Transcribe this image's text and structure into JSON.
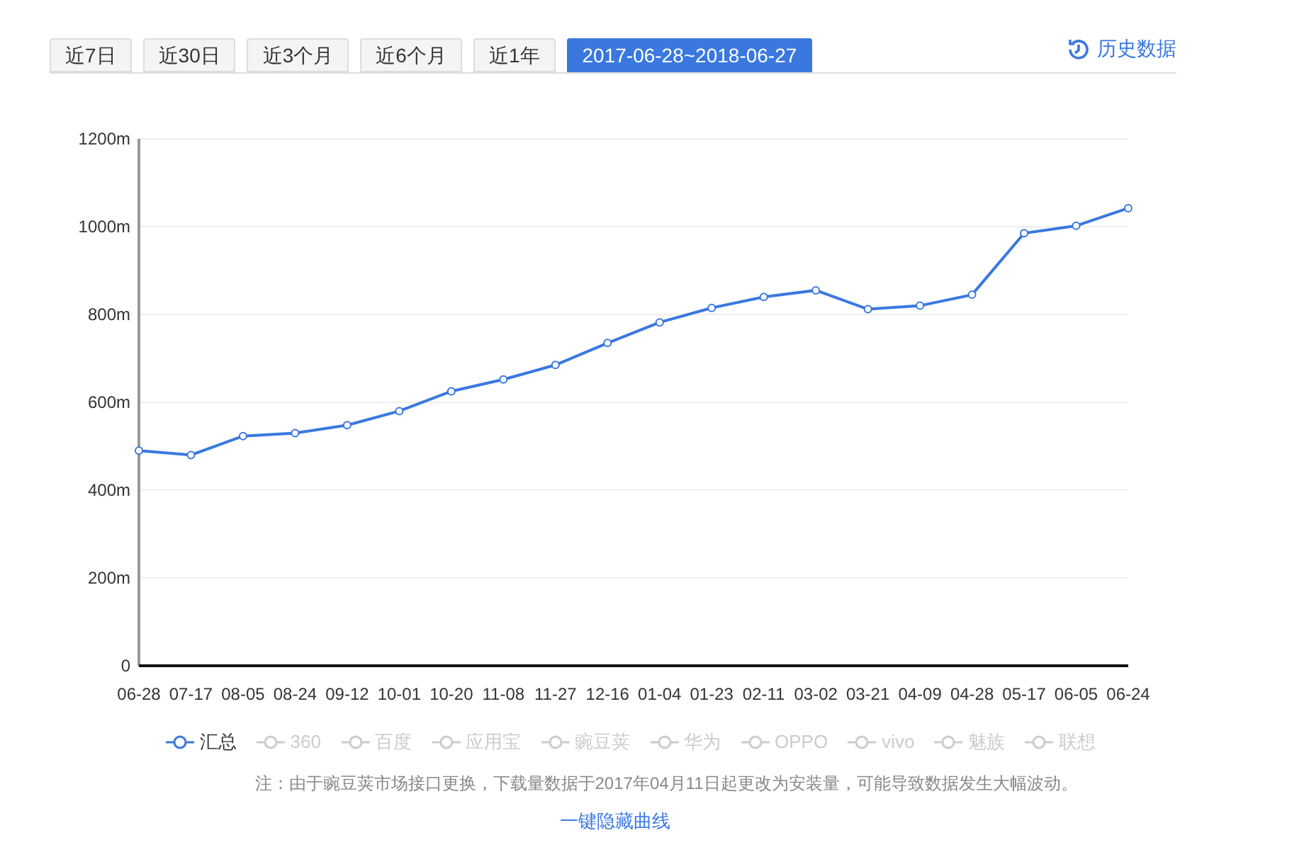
{
  "tabs": [
    {
      "label": "近7日",
      "selected": false
    },
    {
      "label": "近30日",
      "selected": false
    },
    {
      "label": "近3个月",
      "selected": false
    },
    {
      "label": "近6个月",
      "selected": false
    },
    {
      "label": "近1年",
      "selected": false
    },
    {
      "label": "2017-06-28~2018-06-27",
      "selected": true
    }
  ],
  "history_link": "历史数据",
  "chart": {
    "chart_data": {
      "type": "line",
      "categories": [
        "06-28",
        "07-17",
        "08-05",
        "08-24",
        "09-12",
        "10-01",
        "10-20",
        "11-08",
        "11-27",
        "12-16",
        "01-04",
        "01-23",
        "02-11",
        "03-02",
        "03-21",
        "04-09",
        "04-28",
        "05-17",
        "06-05",
        "06-24"
      ],
      "grid": true,
      "series": [
        {
          "name": "汇总",
          "color": "#3a78e0",
          "marker": true,
          "values": [
            490,
            480,
            523,
            530,
            548,
            580,
            625,
            652,
            685,
            735,
            782,
            815,
            840,
            855,
            812,
            820,
            845,
            985,
            1002,
            1042
          ]
        }
      ],
      "ylim": [
        0,
        1200
      ],
      "yticks": [
        {
          "value": 0,
          "label": "0"
        },
        {
          "value": 200,
          "label": "200m"
        },
        {
          "value": 400,
          "label": "400m"
        },
        {
          "value": 600,
          "label": "600m"
        },
        {
          "value": 800,
          "label": "800m"
        },
        {
          "value": 1000,
          "label": "1000m"
        },
        {
          "value": 1200,
          "label": "1200m"
        }
      ]
    }
  },
  "series_legend": [
    {
      "selected": true
    }
  ],
  "legend": [
    {
      "label": "360",
      "selected": false
    },
    {
      "label": "百度",
      "selected": false
    },
    {
      "label": "应用宝",
      "selected": false
    },
    {
      "label": "豌豆荚",
      "selected": false
    },
    {
      "label": "华为",
      "selected": false
    },
    {
      "label": "OPPO",
      "selected": false
    },
    {
      "label": "vivo",
      "selected": false
    },
    {
      "label": "魅族",
      "selected": false
    },
    {
      "label": "联想",
      "selected": false
    }
  ],
  "note": "注：由于豌豆荚市场接口更换，下载量数据于2017年04月11日起更改为安装量，可能导致数据发生大幅波动。",
  "hide_link": "一键隐藏曲线"
}
